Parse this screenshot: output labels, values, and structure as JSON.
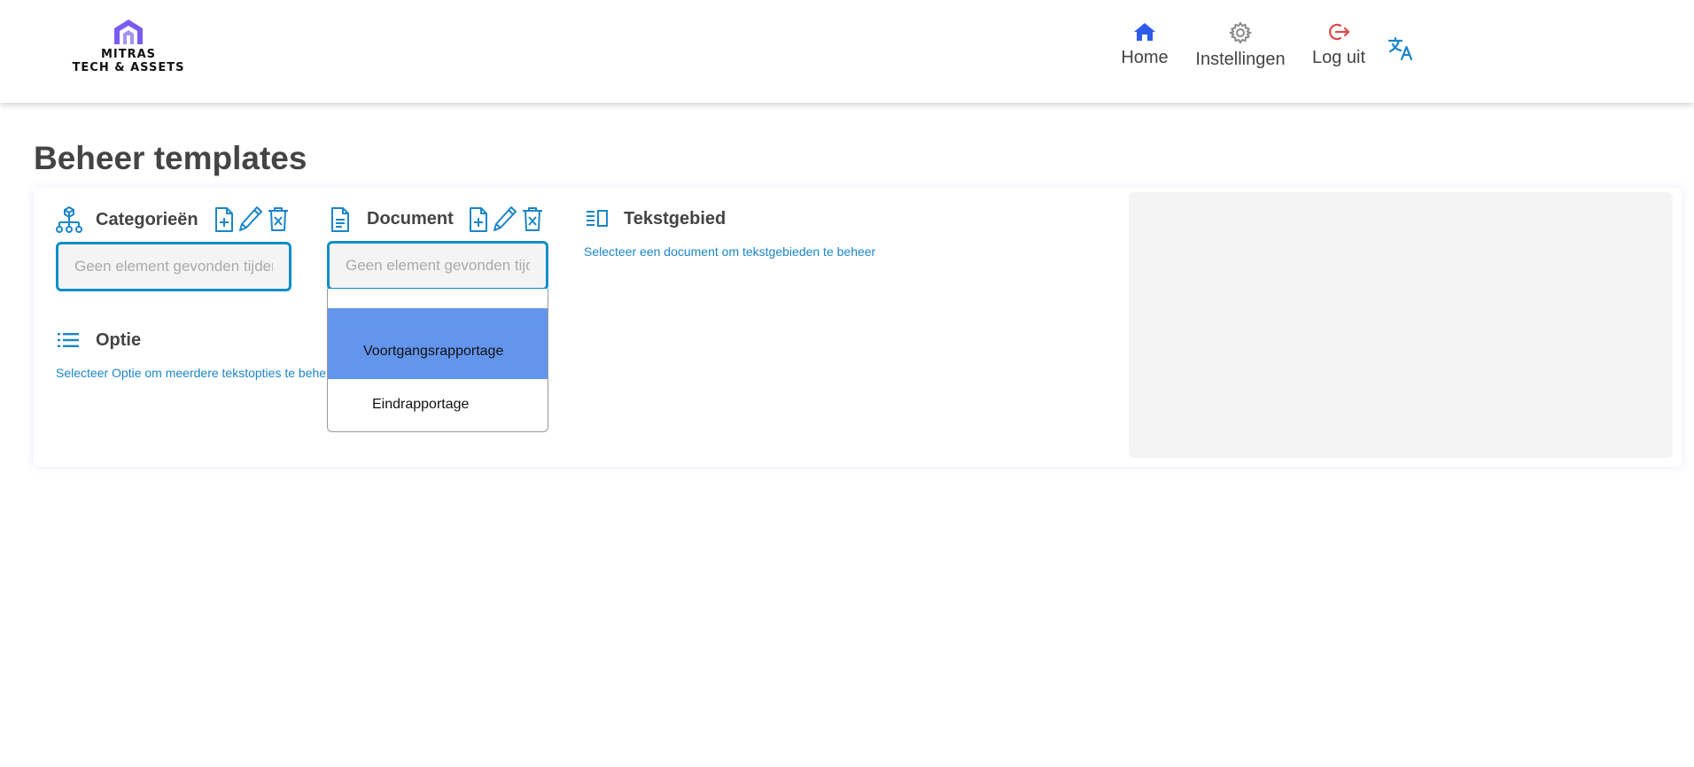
{
  "brand": {
    "line1": "MITRAS",
    "line2": "TECH & ASSETS",
    "accent": "#7b5cf0"
  },
  "nav": {
    "home": "Home",
    "settings": "Instellingen",
    "logout": "Log uit",
    "home_icon": "home-icon",
    "settings_icon": "gear-icon",
    "logout_icon": "logout-icon",
    "language_icon": "translate-icon"
  },
  "page": {
    "title": "Beheer templates"
  },
  "categories": {
    "title": "Categorieën",
    "placeholder": "Geen element gevonden tijdens het zoeken",
    "icon": "hierarchy-icon"
  },
  "document": {
    "title": "Document",
    "placeholder": "Geen element gevonden tijdens het zoeken",
    "icon": "document-icon",
    "options": [
      "Voortgangsrapportage",
      "Eindrapportage"
    ],
    "highlighted": "Voortgangsrapportage"
  },
  "textarea_section": {
    "title": "Tekstgebied",
    "hint": "Selecteer een document om tekstgebieden te beheer",
    "icon": "text-block-icon"
  },
  "option_section": {
    "title": "Optie",
    "hint": "Selecteer Optie om meerdere tekstopties te beheren",
    "icon": "list-icon"
  },
  "colors": {
    "primary": "#0f8fc9",
    "home": "#2f5bea",
    "logout": "#e04848",
    "highlight": "#6395ec"
  }
}
